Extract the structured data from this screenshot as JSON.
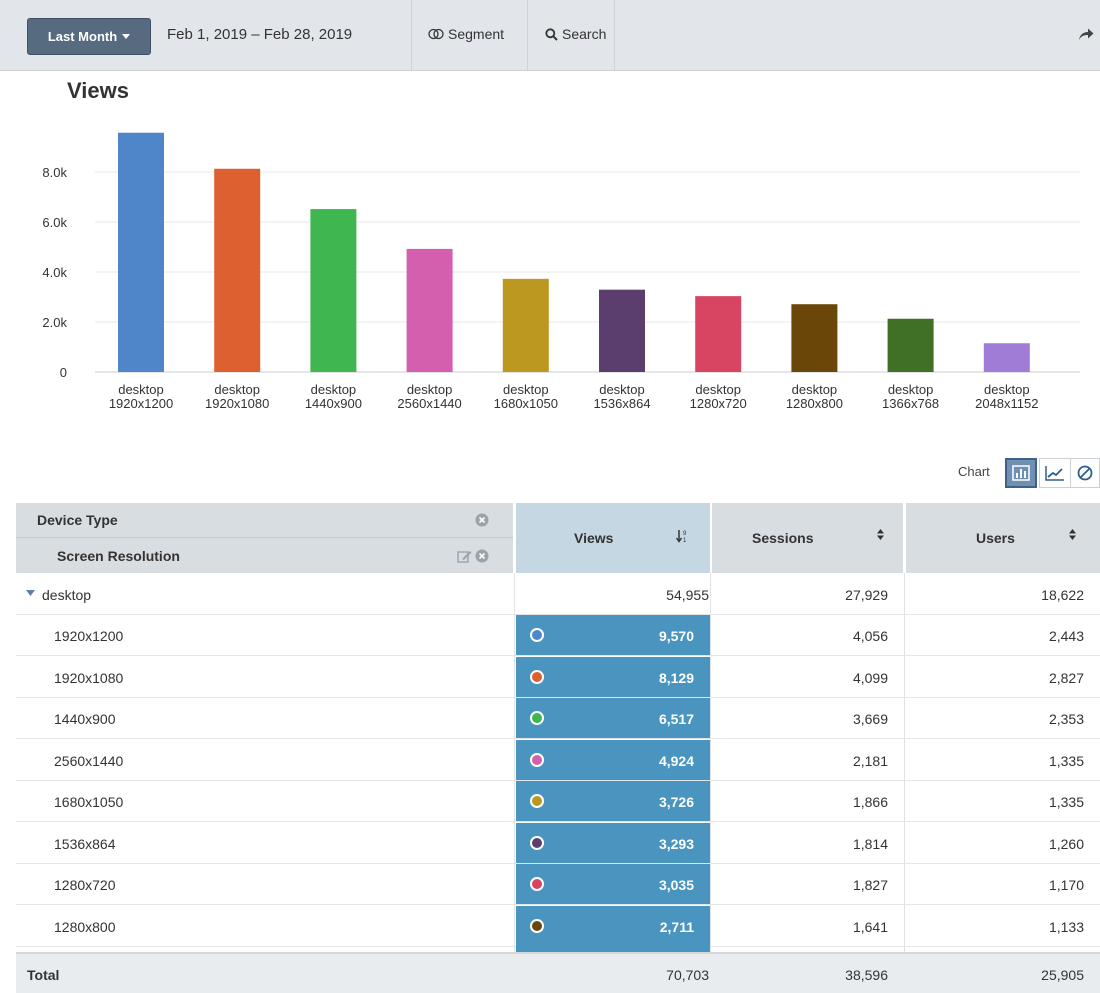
{
  "toolbar": {
    "range_button": "Last Month",
    "date_range": "Feb 1, 2019 – Feb 28, 2019",
    "segment_label": "Segment",
    "search_label": "Search"
  },
  "chart_data": {
    "type": "bar",
    "title": "Views",
    "categories": [
      [
        "desktop",
        "1920x1200"
      ],
      [
        "desktop",
        "1920x1080"
      ],
      [
        "desktop",
        "1440x900"
      ],
      [
        "desktop",
        "2560x1440"
      ],
      [
        "desktop",
        "1680x1050"
      ],
      [
        "desktop",
        "1536x864"
      ],
      [
        "desktop",
        "1280x720"
      ],
      [
        "desktop",
        "1280x800"
      ],
      [
        "desktop",
        "1366x768"
      ],
      [
        "desktop",
        "2048x1152"
      ]
    ],
    "values": [
      9570,
      8129,
      6517,
      4924,
      3726,
      3293,
      3035,
      2711,
      2130,
      1150
    ],
    "colors": [
      "#4f85c9",
      "#dc6030",
      "#3fb650",
      "#d35fae",
      "#bd9820",
      "#5b3e6e",
      "#d84563",
      "#6b4609",
      "#3f7025",
      "#a17cd6"
    ],
    "ylim": [
      0,
      10000
    ],
    "yticks": [
      "0",
      "2.0k",
      "4.0k",
      "6.0k",
      "8.0k"
    ],
    "ytick_values": [
      0,
      2000,
      4000,
      6000,
      8000
    ],
    "grid": true,
    "legend": "none"
  },
  "chart_toggle": {
    "label": "Chart"
  },
  "table": {
    "headers": {
      "device_type": "Device Type",
      "screen_resolution": "Screen Resolution",
      "views": "Views",
      "sessions": "Sessions",
      "users": "Users"
    },
    "group": {
      "name": "desktop",
      "views": "54,955",
      "sessions": "27,929",
      "users": "18,622"
    },
    "rows": [
      {
        "name": "1920x1200",
        "views": "9,570",
        "sessions": "4,056",
        "users": "2,443",
        "color": "#4f85c9"
      },
      {
        "name": "1920x1080",
        "views": "8,129",
        "sessions": "4,099",
        "users": "2,827",
        "color": "#dc6030"
      },
      {
        "name": "1440x900",
        "views": "6,517",
        "sessions": "3,669",
        "users": "2,353",
        "color": "#3fb650"
      },
      {
        "name": "2560x1440",
        "views": "4,924",
        "sessions": "2,181",
        "users": "1,335",
        "color": "#d35fae"
      },
      {
        "name": "1680x1050",
        "views": "3,726",
        "sessions": "1,866",
        "users": "1,335",
        "color": "#bd9820"
      },
      {
        "name": "1536x864",
        "views": "3,293",
        "sessions": "1,814",
        "users": "1,260",
        "color": "#5b3e6e"
      },
      {
        "name": "1280x720",
        "views": "3,035",
        "sessions": "1,827",
        "users": "1,170",
        "color": "#d84563"
      },
      {
        "name": "1280x800",
        "views": "2,711",
        "sessions": "1,641",
        "users": "1,133",
        "color": "#6b4609"
      }
    ],
    "total": {
      "label": "Total",
      "views": "70,703",
      "sessions": "38,596",
      "users": "25,905"
    }
  }
}
